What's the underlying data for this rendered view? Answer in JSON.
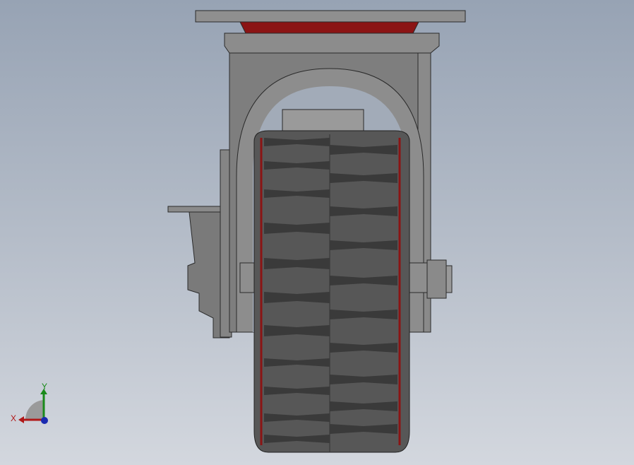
{
  "viewport": {
    "model": "caster-wheel",
    "triad": {
      "x_label": "X",
      "y_label": "Y"
    },
    "colors": {
      "frame": "#7f7f7f",
      "tire": "#555555",
      "tread": "#3a3a3a",
      "rim_accent": "#8b1414",
      "x_axis": "#b01818",
      "y_axis": "#1a8a1a",
      "z_axis": "#1a2ab0"
    }
  }
}
